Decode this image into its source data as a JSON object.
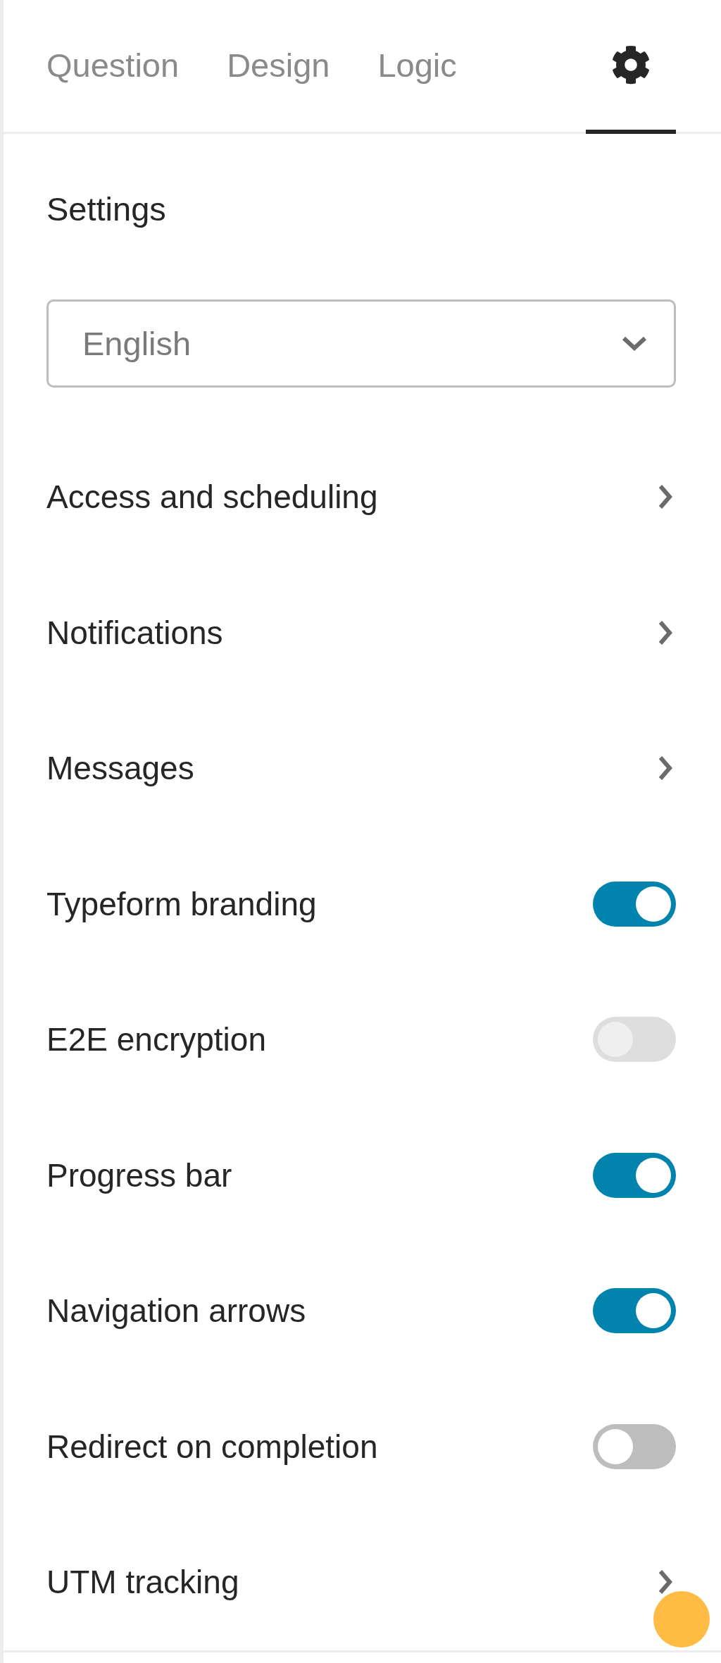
{
  "tabs": [
    {
      "kind": "text",
      "label": "Question",
      "selected": false
    },
    {
      "kind": "text",
      "label": "Design",
      "selected": false
    },
    {
      "kind": "text",
      "label": "Logic",
      "selected": false
    },
    {
      "kind": "icon",
      "selected": true
    }
  ],
  "heading": "Settings",
  "language_select": {
    "value": "English"
  },
  "items": [
    {
      "kind": "link",
      "label": "Access and scheduling"
    },
    {
      "kind": "link",
      "label": "Notifications"
    },
    {
      "kind": "link",
      "label": "Messages"
    },
    {
      "kind": "toggle",
      "label": "Typeform branding",
      "on": true,
      "disabled": false
    },
    {
      "kind": "toggle",
      "label": "E2E encryption",
      "on": false,
      "disabled": true
    },
    {
      "kind": "toggle",
      "label": "Progress bar",
      "on": true,
      "disabled": false
    },
    {
      "kind": "toggle",
      "label": "Navigation arrows",
      "on": true,
      "disabled": false
    },
    {
      "kind": "toggle",
      "label": "Redirect on completion",
      "on": false,
      "disabled": false
    },
    {
      "kind": "link",
      "label": "UTM tracking"
    }
  ]
}
